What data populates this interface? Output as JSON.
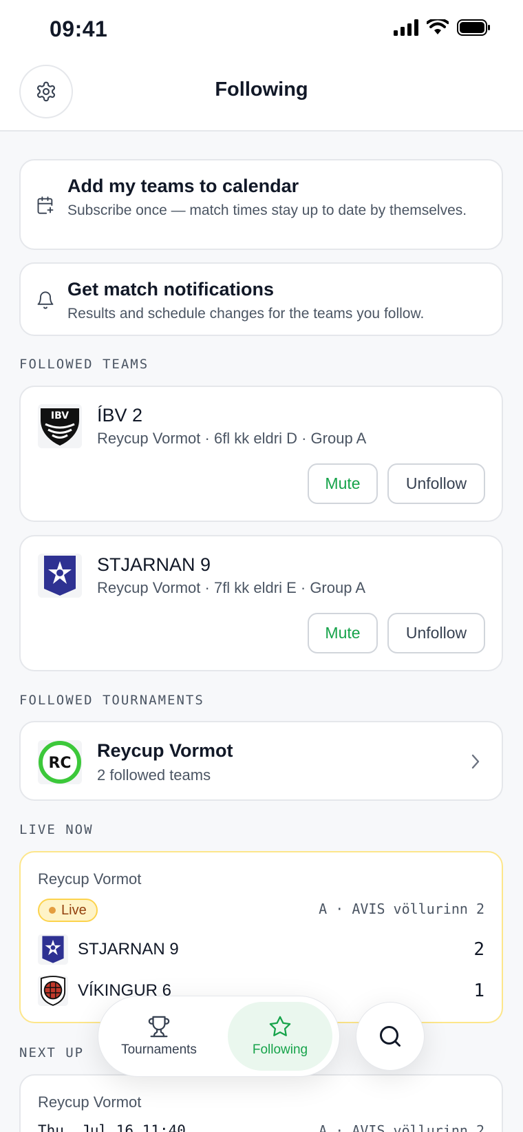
{
  "status_bar": {
    "time": "09:41"
  },
  "header": {
    "title": "Following"
  },
  "calendar_card": {
    "title": "Add my teams to calendar",
    "subtitle": "Subscribe once — match times stay up to date by themselves."
  },
  "notify_card": {
    "title": "Get match notifications",
    "subtitle": "Results and schedule changes for the teams you follow."
  },
  "followed_teams": {
    "label": "FOLLOWED TEAMS",
    "items": [
      {
        "name": "ÍBV 2",
        "meta": "Reycup Vormot · 6fl kk eldri D · Group A",
        "mute_label": "Mute",
        "unfollow_label": "Unfollow"
      },
      {
        "name": "STJARNAN 9",
        "meta": "Reycup Vormot · 7fl kk eldri E · Group A",
        "mute_label": "Mute",
        "unfollow_label": "Unfollow"
      }
    ]
  },
  "followed_tournaments": {
    "label": "FOLLOWED TOURNAMENTS",
    "items": [
      {
        "logo_text": "RC",
        "name": "Reycup Vormot",
        "meta": "2 followed teams"
      }
    ]
  },
  "live_now": {
    "label": "LIVE NOW",
    "match": {
      "tournament": "Reycup Vormot",
      "badge": "Live",
      "venue": "A · AVIS völlurinn 2",
      "home": {
        "name": "STJARNAN 9",
        "score": "2"
      },
      "away": {
        "name": "VÍKINGUR 6",
        "score": "1"
      }
    }
  },
  "next_up": {
    "label": "NEXT UP",
    "match": {
      "tournament": "Reycup Vormot",
      "time": "Thu, Jul 16 11:40",
      "venue": "A · AVIS völlurinn 2"
    }
  },
  "bottom_nav": {
    "tournaments_label": "Tournaments",
    "following_label": "Following"
  },
  "colors": {
    "accent": "#16a34a",
    "live": "#fcd34d",
    "background": "#f7f8fa"
  }
}
